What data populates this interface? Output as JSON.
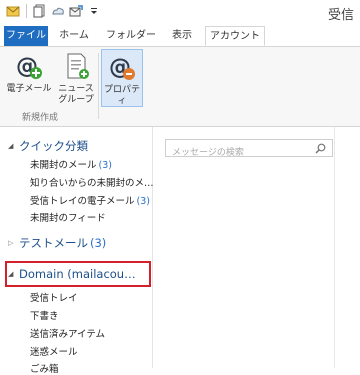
{
  "app": {
    "title": "受信"
  },
  "quick_access": {
    "icons": [
      "mail-app-icon",
      "new-document-icon",
      "cloud-icon",
      "email-send-icon",
      "dropdown-arrow-icon"
    ]
  },
  "ribbon": {
    "tabs": [
      {
        "label": "ファイル",
        "kind": "file"
      },
      {
        "label": "ホーム",
        "kind": "normal"
      },
      {
        "label": "フォルダー",
        "kind": "normal"
      },
      {
        "label": "表示",
        "kind": "normal"
      },
      {
        "label": "アカウント",
        "kind": "active"
      }
    ],
    "buttons": [
      {
        "label": "電子メール",
        "icon": "email-account-icon"
      },
      {
        "label": "ニュース\nグループ",
        "icon": "newsgroup-icon"
      },
      {
        "label": "プロパティ",
        "icon": "properties-icon"
      }
    ],
    "group_label": "新規作成"
  },
  "search": {
    "placeholder": "メッセージの検索"
  },
  "nav": {
    "quick_views": {
      "label": "クイック分類",
      "items": [
        {
          "label": "未開封のメール",
          "count": "(3)"
        },
        {
          "label": "知り合いからの未開封のメ…",
          "count": ""
        },
        {
          "label": "受信トレイの電子メール",
          "count": "(3)"
        },
        {
          "label": "未開封のフィード",
          "count": ""
        }
      ]
    },
    "test_mail": {
      "label": "テストメール",
      "count": "(3)"
    },
    "domain_account": {
      "label": "Domain (mailacou…",
      "items": [
        {
          "label": "受信トレイ"
        },
        {
          "label": "下書き"
        },
        {
          "label": "送信済みアイテム"
        },
        {
          "label": "迷惑メール"
        },
        {
          "label": "ごみ箱"
        }
      ]
    }
  },
  "colors": {
    "file_tab": "#1e6dc0",
    "highlight": "#d4202a",
    "count": "#2a6fc9",
    "section_text": "#1c4f8a"
  }
}
